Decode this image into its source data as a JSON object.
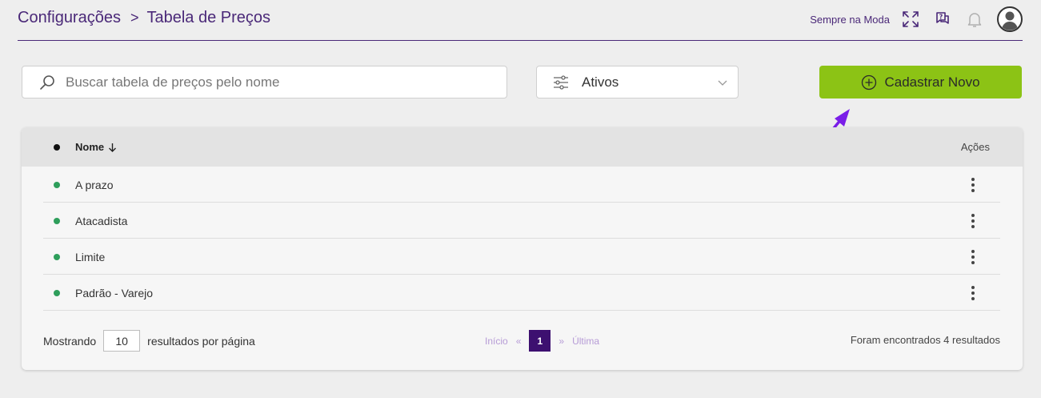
{
  "header": {
    "breadcrumb": [
      "Configurações",
      "Tabela de Preços"
    ],
    "separator": ">",
    "store_name": "Sempre na Moda",
    "icons": [
      "expand-icon",
      "help-chat-icon",
      "bell-icon",
      "user-avatar-icon"
    ]
  },
  "toolbar": {
    "search_placeholder": "Buscar tabela de preços pelo nome",
    "search_value": "",
    "status_filter": "Ativos",
    "new_button_label": "Cadastrar Novo"
  },
  "table": {
    "columns": {
      "name": "Nome",
      "actions": "Ações"
    },
    "rows": [
      {
        "name": "A prazo"
      },
      {
        "name": "Atacadista"
      },
      {
        "name": "Limite"
      },
      {
        "name": "Padrão - Varejo"
      }
    ]
  },
  "footer": {
    "showing_label": "Mostrando",
    "per_page": "10",
    "per_page_label": "resultados por página",
    "pager": {
      "first": "Início",
      "prev": "«",
      "current": "1",
      "next": "»",
      "last": "Última"
    },
    "results_text": "Foram encontrados 4 resultados"
  },
  "colors": {
    "brand_purple": "#4a2878",
    "accent_green": "#8cc315",
    "active_dot": "#2e9e5b",
    "annotation_arrow": "#7a1ee8"
  }
}
